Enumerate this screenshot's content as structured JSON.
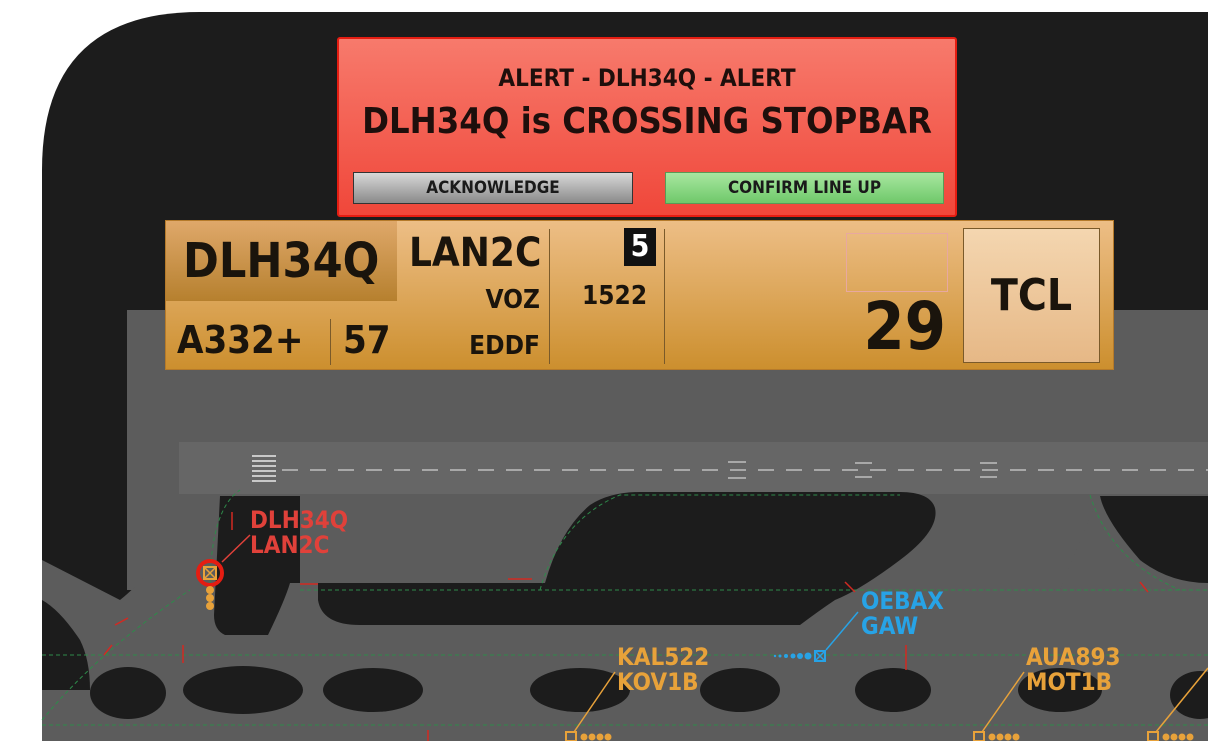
{
  "alert": {
    "line1": "ALERT - DLH34Q - ALERT",
    "line2": "DLH34Q is CROSSING STOPBAR",
    "acknowledge_label": "ACKNOWLEDGE",
    "confirm_label": "CONFIRM LINE UP"
  },
  "flight_strip": {
    "callsign": "DLH34Q",
    "sid": "LAN2C",
    "waypoint": "VOZ",
    "destination": "EDDF",
    "aircraft_type": "A332+",
    "stand": "57",
    "level_badge": "5",
    "squawk": "1522",
    "runway": "29",
    "tcl_label": "TCL"
  },
  "map_labels": {
    "dlh34q": {
      "callsign": "DLH34Q",
      "route": "LAN2C",
      "color": "#e0413a"
    },
    "oebax": {
      "callsign": "OEBAX",
      "route": "GAW",
      "color": "#27a3e6"
    },
    "kal522": {
      "callsign": "KAL522",
      "route": "KOV1B",
      "color": "#e8a23a"
    },
    "aua893": {
      "callsign": "AUA893",
      "route": "MOT1B",
      "color": "#e8a23a"
    }
  },
  "colors": {
    "background": "#1a1a1a",
    "taxiway": "#5e5e5e",
    "alert_red": "#f0473a",
    "strip_orange": "#dba25a"
  }
}
